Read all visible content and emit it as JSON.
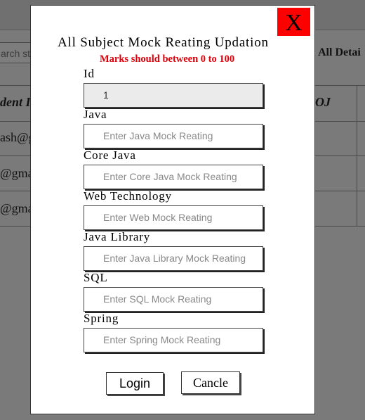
{
  "background": {
    "search_placeholder": "arch stu",
    "details_label": "All Detai",
    "header_left": "dent I",
    "header_right": "OJ",
    "rows": [
      "ash@g",
      "@gma",
      "@gma"
    ]
  },
  "modal": {
    "close_label": "X",
    "title": "All Subject Mock Reating Updation",
    "subtitle": "Marks should between 0 to 100",
    "fields": [
      {
        "label": "Id",
        "value": "1",
        "placeholder": ""
      },
      {
        "label": "Java",
        "value": "",
        "placeholder": "Enter Java Mock Reating"
      },
      {
        "label": "Core Java",
        "value": "",
        "placeholder": "Enter Core Java Mock Reating"
      },
      {
        "label": "Web Technology",
        "value": "",
        "placeholder": "Enter Web Mock Reating"
      },
      {
        "label": "Java Library",
        "value": "",
        "placeholder": "Enter Java Library Mock Reating"
      },
      {
        "label": "SQL",
        "value": "",
        "placeholder": "Enter SQL Mock Reating"
      },
      {
        "label": "Spring",
        "value": "",
        "placeholder": "Enter Spring Mock Reating"
      }
    ],
    "login_label": "Login",
    "cancel_label": "Cancle"
  },
  "colors": {
    "close_bg": "#ff0000",
    "subtitle": "#e0000a",
    "overlay": "#7a7a7a"
  }
}
